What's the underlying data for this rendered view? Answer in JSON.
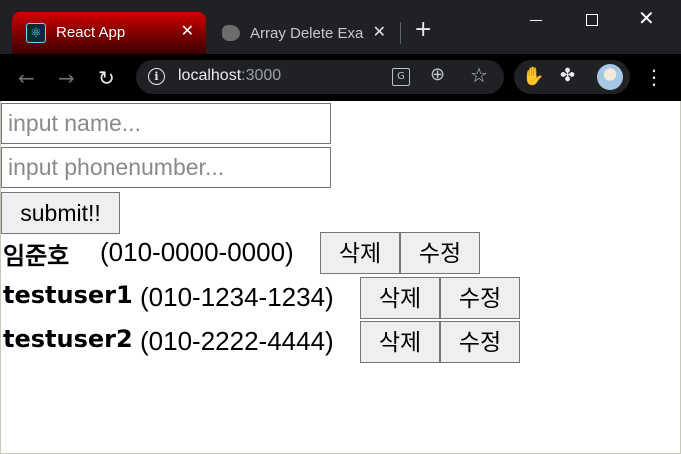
{
  "browser": {
    "active_tab": {
      "title": "React App",
      "close": "✕"
    },
    "inactive_tab": {
      "title": "Array Delete Exa",
      "close": "✕"
    },
    "new_tab": "+",
    "url_host": "localhost",
    "url_port": ":3000",
    "window_controls": {
      "close": "✕"
    }
  },
  "form": {
    "name_placeholder": "input name...",
    "phone_placeholder": "input phonenumber...",
    "submit_label": "submit!!"
  },
  "contacts": [
    {
      "name": "임준호",
      "phone": "(010-0000-0000)",
      "delete_label": "삭제",
      "edit_label": "수정"
    },
    {
      "name": "testuser1",
      "phone": "(010-1234-1234)",
      "delete_label": "삭제",
      "edit_label": "수정"
    },
    {
      "name": "testuser2",
      "phone": "(010-2222-4444)",
      "delete_label": "삭제",
      "edit_label": "수정"
    }
  ]
}
